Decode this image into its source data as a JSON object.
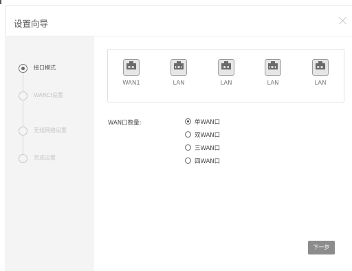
{
  "dialog": {
    "title": "设置向导"
  },
  "steps": [
    {
      "label": "接口模式",
      "active": true
    },
    {
      "label": "WAN口设置",
      "active": false
    },
    {
      "label": "无线网络设置",
      "active": false
    },
    {
      "label": "完成设置",
      "active": false
    }
  ],
  "ports": [
    {
      "label": "WAN1",
      "icon": "ethernet-port-icon"
    },
    {
      "label": "LAN",
      "icon": "ethernet-port-icon"
    },
    {
      "label": "LAN",
      "icon": "ethernet-port-icon"
    },
    {
      "label": "LAN",
      "icon": "ethernet-port-icon"
    },
    {
      "label": "LAN",
      "icon": "ethernet-port-icon"
    }
  ],
  "wan_count": {
    "label": "WAN口数量:",
    "options": [
      {
        "label": "单WAN口",
        "checked": true
      },
      {
        "label": "双WAN口",
        "checked": false
      },
      {
        "label": "三WAN口",
        "checked": false
      },
      {
        "label": "四WAN口",
        "checked": false
      }
    ]
  },
  "buttons": {
    "next": "下一步"
  },
  "colors": {
    "sidebar_bg": "#f4f4f4",
    "button_bg": "#8c8c8c",
    "active_text": "#555555",
    "inactive_text": "#c6c6c6"
  }
}
